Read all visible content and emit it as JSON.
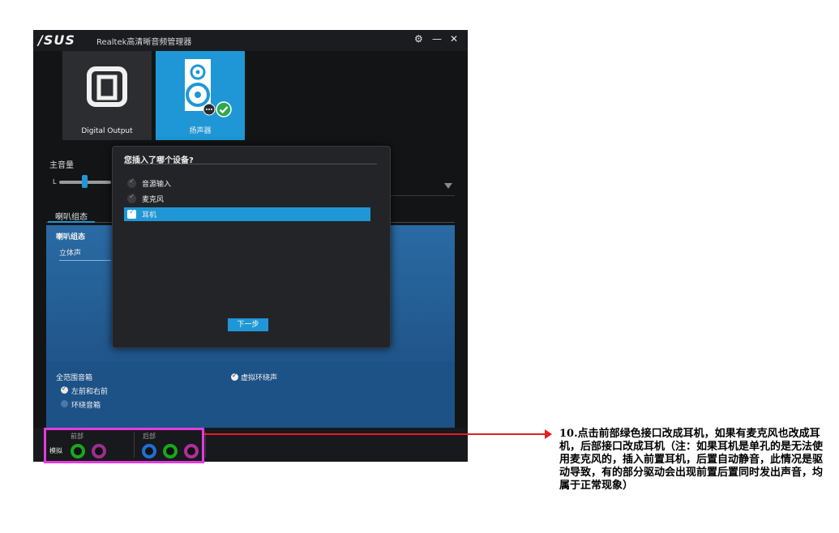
{
  "window": {
    "logo": "/SUS",
    "title": "Realtek高清晰音频管理器",
    "controls": [
      "⚙",
      "—",
      "✕"
    ]
  },
  "devices": [
    {
      "label": "Digital Output",
      "icon": "digital-output-icon"
    },
    {
      "label": "扬声器",
      "icon": "speaker-icon",
      "selected": true
    }
  ],
  "volume": {
    "label": "主音量",
    "left_channel": "L",
    "level": 0.55
  },
  "tabs": [
    {
      "label": "喇叭组态",
      "active": true
    }
  ],
  "panel": {
    "title": "喇叭组态",
    "combo_value": "立体声"
  },
  "fullrange": {
    "label": "全范围音箱",
    "options": [
      {
        "label": "左前和右前",
        "checked": true
      },
      {
        "label": "环绕音箱",
        "checked": false
      }
    ]
  },
  "virtual_surround": {
    "label": "虚拟环绕声",
    "checked": true
  },
  "jacks": {
    "row_label": "模拟",
    "front_label": "前部",
    "back_label": "后部",
    "front": [
      "#1aa61a",
      "#9b2f8e"
    ],
    "back": [
      "#1f6fd6",
      "#1aa61a",
      "#b02f9a"
    ]
  },
  "dialog": {
    "title": "您插入了哪个设备?",
    "options": [
      {
        "label": "音源输入",
        "selected": false
      },
      {
        "label": "麦克风",
        "selected": false
      },
      {
        "label": "耳机",
        "selected": true
      }
    ],
    "next_label": "下一步"
  },
  "annotation": {
    "text": "10.点击前部绿色接口改成耳机，如果有麦克风也改成耳机，后部接口改成耳机（注：如果耳机是单孔的是无法使用麦克风的，插入前置耳机，后置自动静音，此情况是驱动导致，有的部分驱动会出现前置后置同时发出声音，均属于正常现象）"
  },
  "colors": {
    "accent": "#1f97d6",
    "highlight_border": "#e23be0",
    "arrow": "#e02020"
  }
}
